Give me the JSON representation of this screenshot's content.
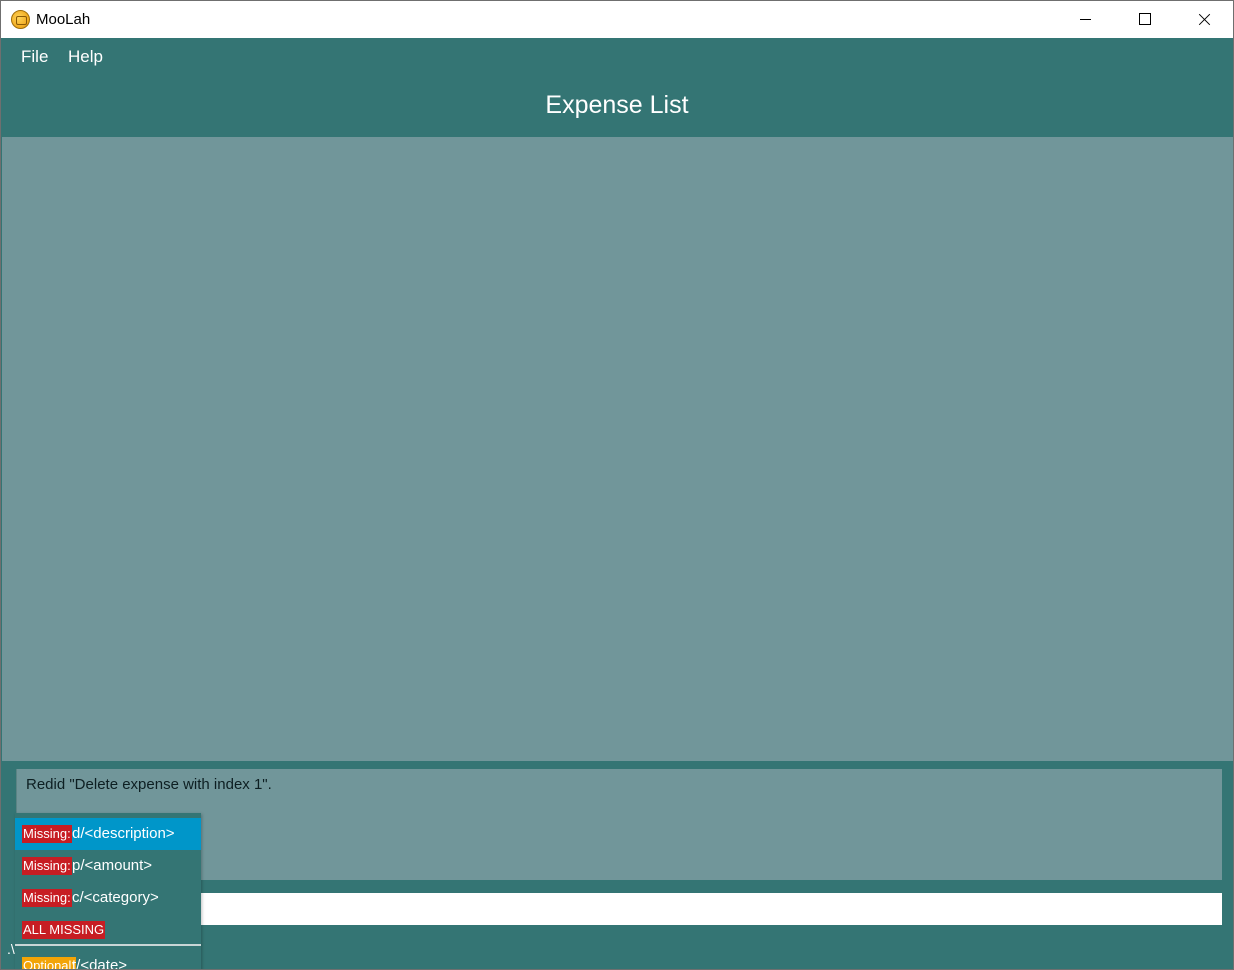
{
  "window": {
    "title": "MooLah"
  },
  "menu": {
    "items": [
      {
        "label": "File"
      },
      {
        "label": "Help"
      }
    ]
  },
  "panel": {
    "title": "Expense List"
  },
  "result": {
    "text": "Redid \"Delete expense with index 1\"."
  },
  "command": {
    "value": ""
  },
  "status": {
    "path": ".\\"
  },
  "autocomplete": {
    "items": [
      {
        "tag": "Missing:",
        "param": "d/<description>",
        "tag_color": "#c71d23",
        "selected": true
      },
      {
        "tag": "Missing:",
        "param": "p/<amount>",
        "tag_color": "#c71d23",
        "selected": false
      },
      {
        "tag": "Missing:",
        "param": "c/<category>",
        "tag_color": "#c71d23",
        "selected": false
      },
      {
        "tag": "ALL MISSING",
        "param": "",
        "tag_color": "#c71d23",
        "selected": false
      },
      {
        "tag": "Optional:",
        "param": "t/<date>",
        "tag_color": "#f2a407",
        "selected": false
      }
    ]
  },
  "colors": {
    "background": "#347574",
    "panel": "#71969a",
    "selected": "#0096c9",
    "missing": "#c71d23",
    "optional": "#f2a407"
  }
}
